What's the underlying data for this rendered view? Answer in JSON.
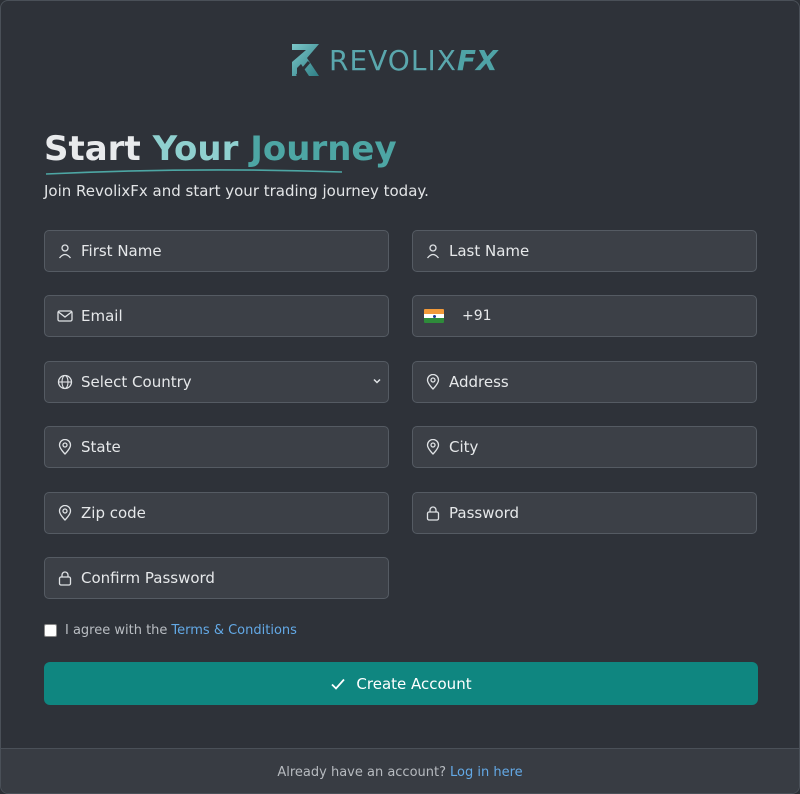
{
  "brand": {
    "name_main": "REVOLIX",
    "name_suffix": "FX"
  },
  "heading": {
    "word1": "Start",
    "word2": "Your",
    "word3": "Journey"
  },
  "subtitle": "Join RevolixFx and start your trading journey today.",
  "fields": {
    "first_name": "First Name",
    "last_name": "Last Name",
    "email": "Email",
    "phone_code": "+91",
    "country": "Select Country",
    "address": "Address",
    "state": "State",
    "city": "City",
    "zip": "Zip code",
    "password": "Password",
    "confirm_password": "Confirm Password"
  },
  "terms": {
    "prefix": "I agree with the",
    "link": "Terms & Conditions",
    "checked": false
  },
  "create_button": "Create Account",
  "footer": {
    "prefix": "Already have an account?",
    "link": "Log in here"
  },
  "colors": {
    "accent": "#0f8680",
    "link": "#63a9e6",
    "background": "#2e3239",
    "field": "#3c4047"
  },
  "icons": {
    "first_name": "user-icon",
    "last_name": "user-icon",
    "email": "envelope-icon",
    "phone": "india-flag-icon",
    "country": "globe-icon",
    "address": "map-pin-icon",
    "state": "map-pin-icon",
    "city": "map-pin-icon",
    "zip": "map-pin-icon",
    "password": "lock-icon",
    "confirm_password": "lock-icon",
    "create": "check-icon"
  }
}
